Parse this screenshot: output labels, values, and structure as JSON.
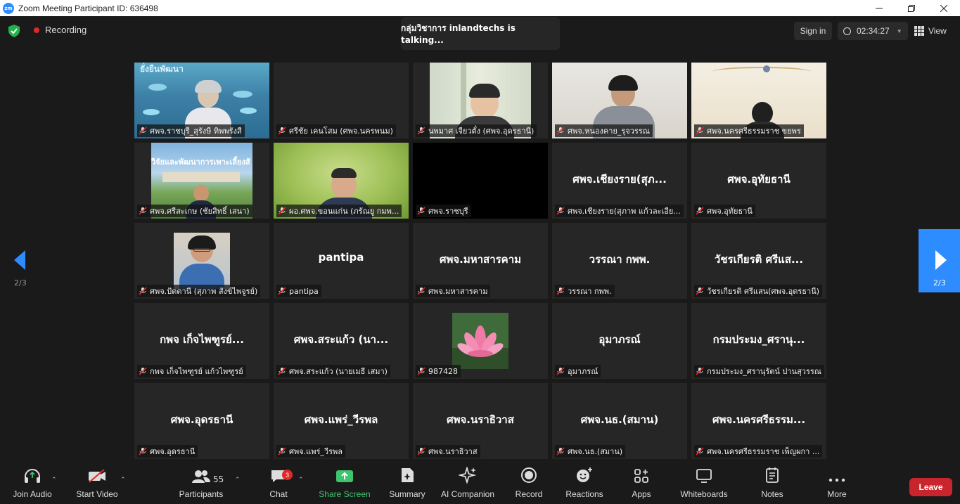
{
  "window": {
    "title": "Zoom Meeting Participant ID: 636498",
    "logo": "zm"
  },
  "topbar": {
    "recording_label": "Recording",
    "talking_text": "กลุ่มวิชาการ inlandtechs  is  talking...",
    "signin_label": "Sign in",
    "timer": "02:34:27",
    "view_label": "View"
  },
  "navigation": {
    "page_left": "2/3",
    "page_right": "2/3"
  },
  "participants": [
    {
      "name": "ศพจ.ราชบุรี_สุรังษี ทิพพรังสี",
      "center": ""
    },
    {
      "name": "ศรีชัย เคนโสม (ศพจ.นครพนม)",
      "center": ""
    },
    {
      "name": "นพมาศ เจียวตั๋ง (ศพจ.อุดรธานี)",
      "center": ""
    },
    {
      "name": "ศพจ.หนองคาย_รุจวรรณ",
      "center": ""
    },
    {
      "name": "ศพจ.นครศรีธรรมราช ขยพร",
      "center": ""
    },
    {
      "name": "ศพจ.ศรีสะเกษ (ชัยสิทธิ์ เสนา)",
      "center": ""
    },
    {
      "name": "ผอ.ศพจ.ขอนแก่น (ภรัณยู กมพ...",
      "center": ""
    },
    {
      "name": "ศพจ.ราชบุรี",
      "center": ""
    },
    {
      "name": "ศพจ.เชียงราย(สุภาพ แก้วละเอีย...",
      "center": "ศพจ.เชียงราย(สุภ..."
    },
    {
      "name": "ศพจ.อุทัยธานี",
      "center": "ศพจ.อุทัยธานี"
    },
    {
      "name": "ศพจ.ปัตตานี (สุภาพ สังข์ไพจูรย์)",
      "center": ""
    },
    {
      "name": "pantipa",
      "center": "pantipa"
    },
    {
      "name": "ศพจ.มหาสารคาม",
      "center": "ศพจ.มหาสารคาม"
    },
    {
      "name": "วรรณา กพพ.",
      "center": "วรรณา กพพ."
    },
    {
      "name": "วัชรเกียรติ ศรีแสน(ศพจ.อุดรธานี)",
      "center": "วัชรเกียรติ ศรีแส..."
    },
    {
      "name": "กพจ เก็จไพฑูรย์ แก้วไพฑูรย์",
      "center": "กพจ เก็จไพฑูรย์..."
    },
    {
      "name": "ศพจ.สระแก้ว (นายเมธี เสมา)",
      "center": "ศพจ.สระแก้ว (นา..."
    },
    {
      "name": "987428",
      "center": ""
    },
    {
      "name": "อุมาภรณ์",
      "center": "อุมาภรณ์"
    },
    {
      "name": "กรมประมง_ศรานุรัตน์ ปานสุวรรณ",
      "center": "กรมประมง_ศรานุ..."
    },
    {
      "name": "ศพจ.อุดรธานี",
      "center": "ศพจ.อุดรธานี"
    },
    {
      "name": "ศพจ.แพร่_วีรพล",
      "center": "ศพจ.แพร่_วีรพล"
    },
    {
      "name": "ศพจ.นราธิวาส",
      "center": "ศพจ.นราธิวาส"
    },
    {
      "name": "ศพจ.นธ.(สมาน)",
      "center": "ศพจ.นธ.(สมาน)"
    },
    {
      "name": "ศพจ.นครศรีธรรมราช เพ็ญผกา ...",
      "center": "ศพจ.นครศรีธรรม..."
    }
  ],
  "thumbnail_text": {
    "banner1": "ยั่งยืนพัฒนา",
    "banner2": "วิจัยและพัฒนาการเพาะเลี้ยงสั"
  },
  "toolbar": {
    "join_audio": "Join Audio",
    "start_video": "Start Video",
    "participants": "Participants",
    "participants_count": "55",
    "chat": "Chat",
    "chat_badge": "3",
    "share_screen": "Share Screen",
    "summary": "Summary",
    "ai_companion": "AI Companion",
    "record": "Record",
    "reactions": "Reactions",
    "apps": "Apps",
    "whiteboards": "Whiteboards",
    "notes": "Notes",
    "more": "More",
    "leave": "Leave"
  },
  "colors": {
    "accent": "#2d8cff",
    "leave": "#c9252c",
    "share": "#3ec46d",
    "muted": "#e02828"
  }
}
